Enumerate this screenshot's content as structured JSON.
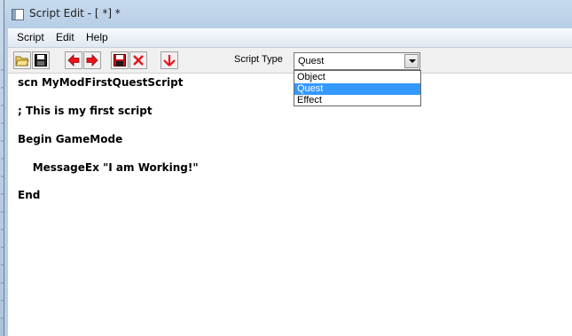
{
  "window": {
    "title": "Script Edit - [ *] *"
  },
  "menu": {
    "items": [
      "Script",
      "Edit",
      "Help"
    ]
  },
  "toolbar": {
    "buttons": [
      {
        "icon": "open-folder-icon"
      },
      {
        "icon": "save-disk-icon"
      },
      {
        "icon": "arrow-left-icon"
      },
      {
        "icon": "arrow-right-icon"
      },
      {
        "icon": "save-red-disk-icon"
      },
      {
        "icon": "close-x-icon"
      },
      {
        "icon": "arrow-down-icon"
      }
    ],
    "script_type_label": "Script Type",
    "script_type_value": "Quest"
  },
  "dropdown": {
    "options": [
      "Object",
      "Quest",
      "Effect"
    ],
    "selected": "Quest"
  },
  "editor": {
    "lines": [
      "scn MyModFirstQuestScript",
      "; This is my first script",
      "Begin GameMode",
      "    MessageEx \"I am Working!\"",
      "End"
    ]
  },
  "colors": {
    "selection": "#3399ff",
    "arrow_red": "#e8121b",
    "frame": "#b8cee6"
  }
}
